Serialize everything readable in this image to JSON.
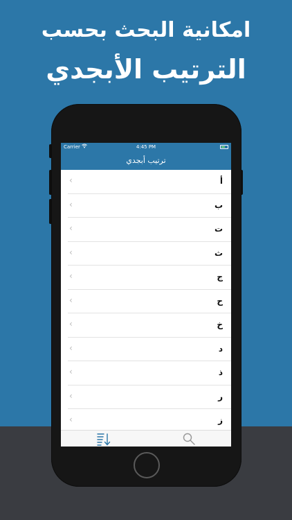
{
  "promo": {
    "line1": "امكانية البحث بحسب",
    "line2": "الترتيب الأبجدي"
  },
  "status_bar": {
    "carrier": "Carrier",
    "time": "4:45 PM"
  },
  "nav": {
    "title": "ترتيب أبجدي"
  },
  "list": {
    "items": [
      {
        "letter": "أ"
      },
      {
        "letter": "ب"
      },
      {
        "letter": "ت"
      },
      {
        "letter": "ث"
      },
      {
        "letter": "ج"
      },
      {
        "letter": "ح"
      },
      {
        "letter": "خ"
      },
      {
        "letter": "د"
      },
      {
        "letter": "ذ"
      },
      {
        "letter": "ر"
      },
      {
        "letter": "ز"
      }
    ]
  },
  "tabs": [
    {
      "icon": "sort-alphabetical-icon"
    },
    {
      "icon": "search-icon"
    }
  ],
  "colors": {
    "brand_blue": "#2c77a8",
    "dark_band": "#3a3c41",
    "tab_active": "#2c77a8",
    "tab_inactive": "#9a9a9a"
  }
}
